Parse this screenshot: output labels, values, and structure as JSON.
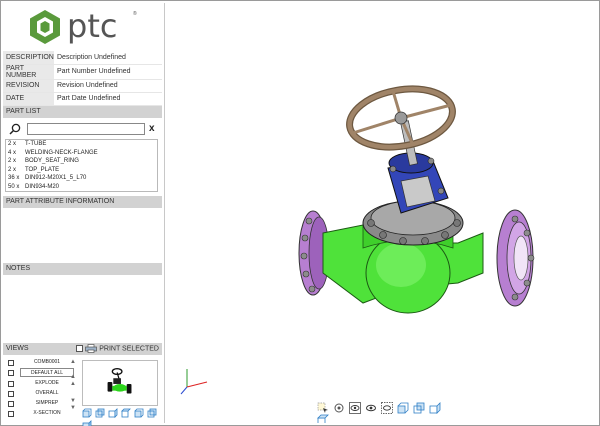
{
  "brand": {
    "name": "ptc",
    "reg": "®",
    "accent": "#5a9a3c",
    "icon": "ptc-logo-icon"
  },
  "metadata": [
    {
      "key": "DESCRIPTION",
      "value": "Description Undefined"
    },
    {
      "key": "PART NUMBER",
      "value": "Part Number Undefined"
    },
    {
      "key": "REVISION",
      "value": "Revision Undefined"
    },
    {
      "key": "DATE",
      "value": "Part Date Undefined"
    }
  ],
  "part_list": {
    "title": "PART LIST",
    "search_value": "",
    "clear_label": "x",
    "items": [
      {
        "qty": "2 x",
        "name": "T-TUBE"
      },
      {
        "qty": "4 x",
        "name": "WELDING-NECK-FLANGE"
      },
      {
        "qty": "2 x",
        "name": "BODY_SEAT_RING"
      },
      {
        "qty": "2 x",
        "name": "TOP_PLATE"
      },
      {
        "qty": "36 x",
        "name": "DIN912-M20X1_5_L70"
      },
      {
        "qty": "50 x",
        "name": "DIN934-M20"
      }
    ]
  },
  "part_attributes": {
    "title": "PART ATTRIBUTE INFORMATION"
  },
  "notes": {
    "title": "NOTES"
  },
  "views": {
    "title": "VIEWS",
    "print_label": "PRINT SELECTED",
    "items": [
      "COMB0001",
      "DEFAULT ALL",
      "EXPLODE",
      "OVERALL",
      "SIMPREP",
      "X-SECTION"
    ],
    "selected": "DEFAULT ALL"
  },
  "colors": {
    "body_green": "#4fe23a",
    "flange_purple": "#b77fd1",
    "bolt_gray": "#8c8c8c",
    "bonnet_blue": "#3346b8",
    "wheel_brown": "#a08468"
  }
}
